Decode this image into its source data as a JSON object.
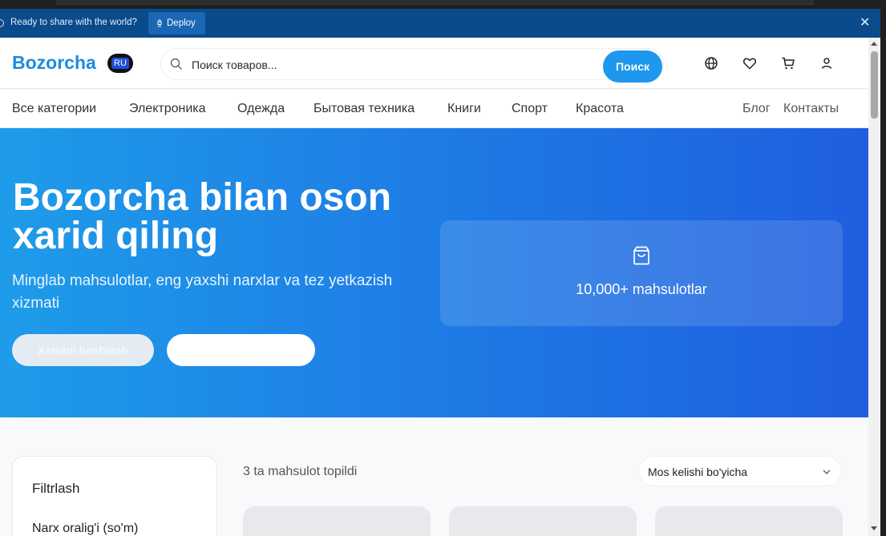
{
  "banner": {
    "message": "Ready to share with the world?",
    "deploy_label": "Deploy"
  },
  "header": {
    "logo": "Bozorcha",
    "lang_badge": "RU",
    "search_placeholder": "Поиск товаров...",
    "search_button": "Поиск",
    "icons": [
      "globe-icon",
      "heart-icon",
      "cart-icon",
      "user-icon"
    ]
  },
  "nav": {
    "items": [
      "Все категории",
      "Электроника",
      "Одежда",
      "Бытовая техника",
      "Книги",
      "Спорт",
      "Красота"
    ],
    "right": [
      "Блог",
      "Контакты"
    ]
  },
  "hero": {
    "title": "Bozorcha bilan oson xarid qiling",
    "subtitle": "Minglab mahsulotlar, eng yaxshi narxlar va tez yetkazish xizmati",
    "primary_button": "Xaridni boshlash",
    "secondary_button": "",
    "stat_text": "10,000+ mahsulotlar"
  },
  "filters": {
    "title": "Filtrlash",
    "price_range_label": "Narx oralig'i (so'm)"
  },
  "results": {
    "count_text": "3 ta mahsulot topildi",
    "sort_value": "Mos kelishi bo'yicha"
  },
  "colors": {
    "brand": "#1c8be0",
    "banner": "#0a4b8c",
    "hero_start": "#1e9ce9",
    "hero_end": "#1f5ee0",
    "search_button": "#1e97ee"
  }
}
